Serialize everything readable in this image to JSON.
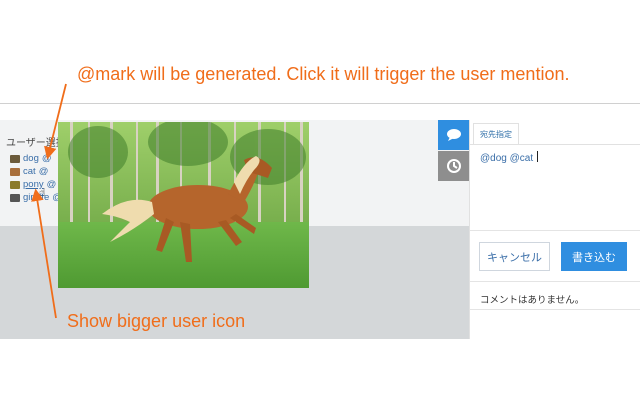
{
  "annotations": {
    "top": "@mark will be generated. Click it will trigger the user mention.",
    "bottom": "Show bigger user icon"
  },
  "user_select": {
    "title": "ユーザー選択",
    "users": [
      {
        "name": "dog",
        "at": "@",
        "icon": "dog-icon",
        "color": "#6b5a3a"
      },
      {
        "name": "cat",
        "at": "@",
        "icon": "cat-icon",
        "color": "#a86f3c"
      },
      {
        "name": "pony",
        "at": "@",
        "icon": "pony-icon",
        "color": "#8a7a2a"
      },
      {
        "name": "giraffe",
        "at": "@",
        "icon": "giraffe-icon",
        "color": "#555555"
      }
    ]
  },
  "photo": {
    "subject": "horse-photo"
  },
  "comment_panel": {
    "tab_label": "宛先指定",
    "editor_text": "@dog @cat",
    "cancel_label": "キャンセル",
    "write_label": "書き込む",
    "empty_message": "コメントはありません。"
  },
  "side_tabs": [
    {
      "icon": "comment-icon",
      "color": "#2f8ee0"
    },
    {
      "icon": "history-icon",
      "color": "#8e8e8e"
    }
  ],
  "colors": {
    "annotation": "#f06d1a",
    "accent": "#2f8ee0",
    "link": "#3a6ea8"
  }
}
